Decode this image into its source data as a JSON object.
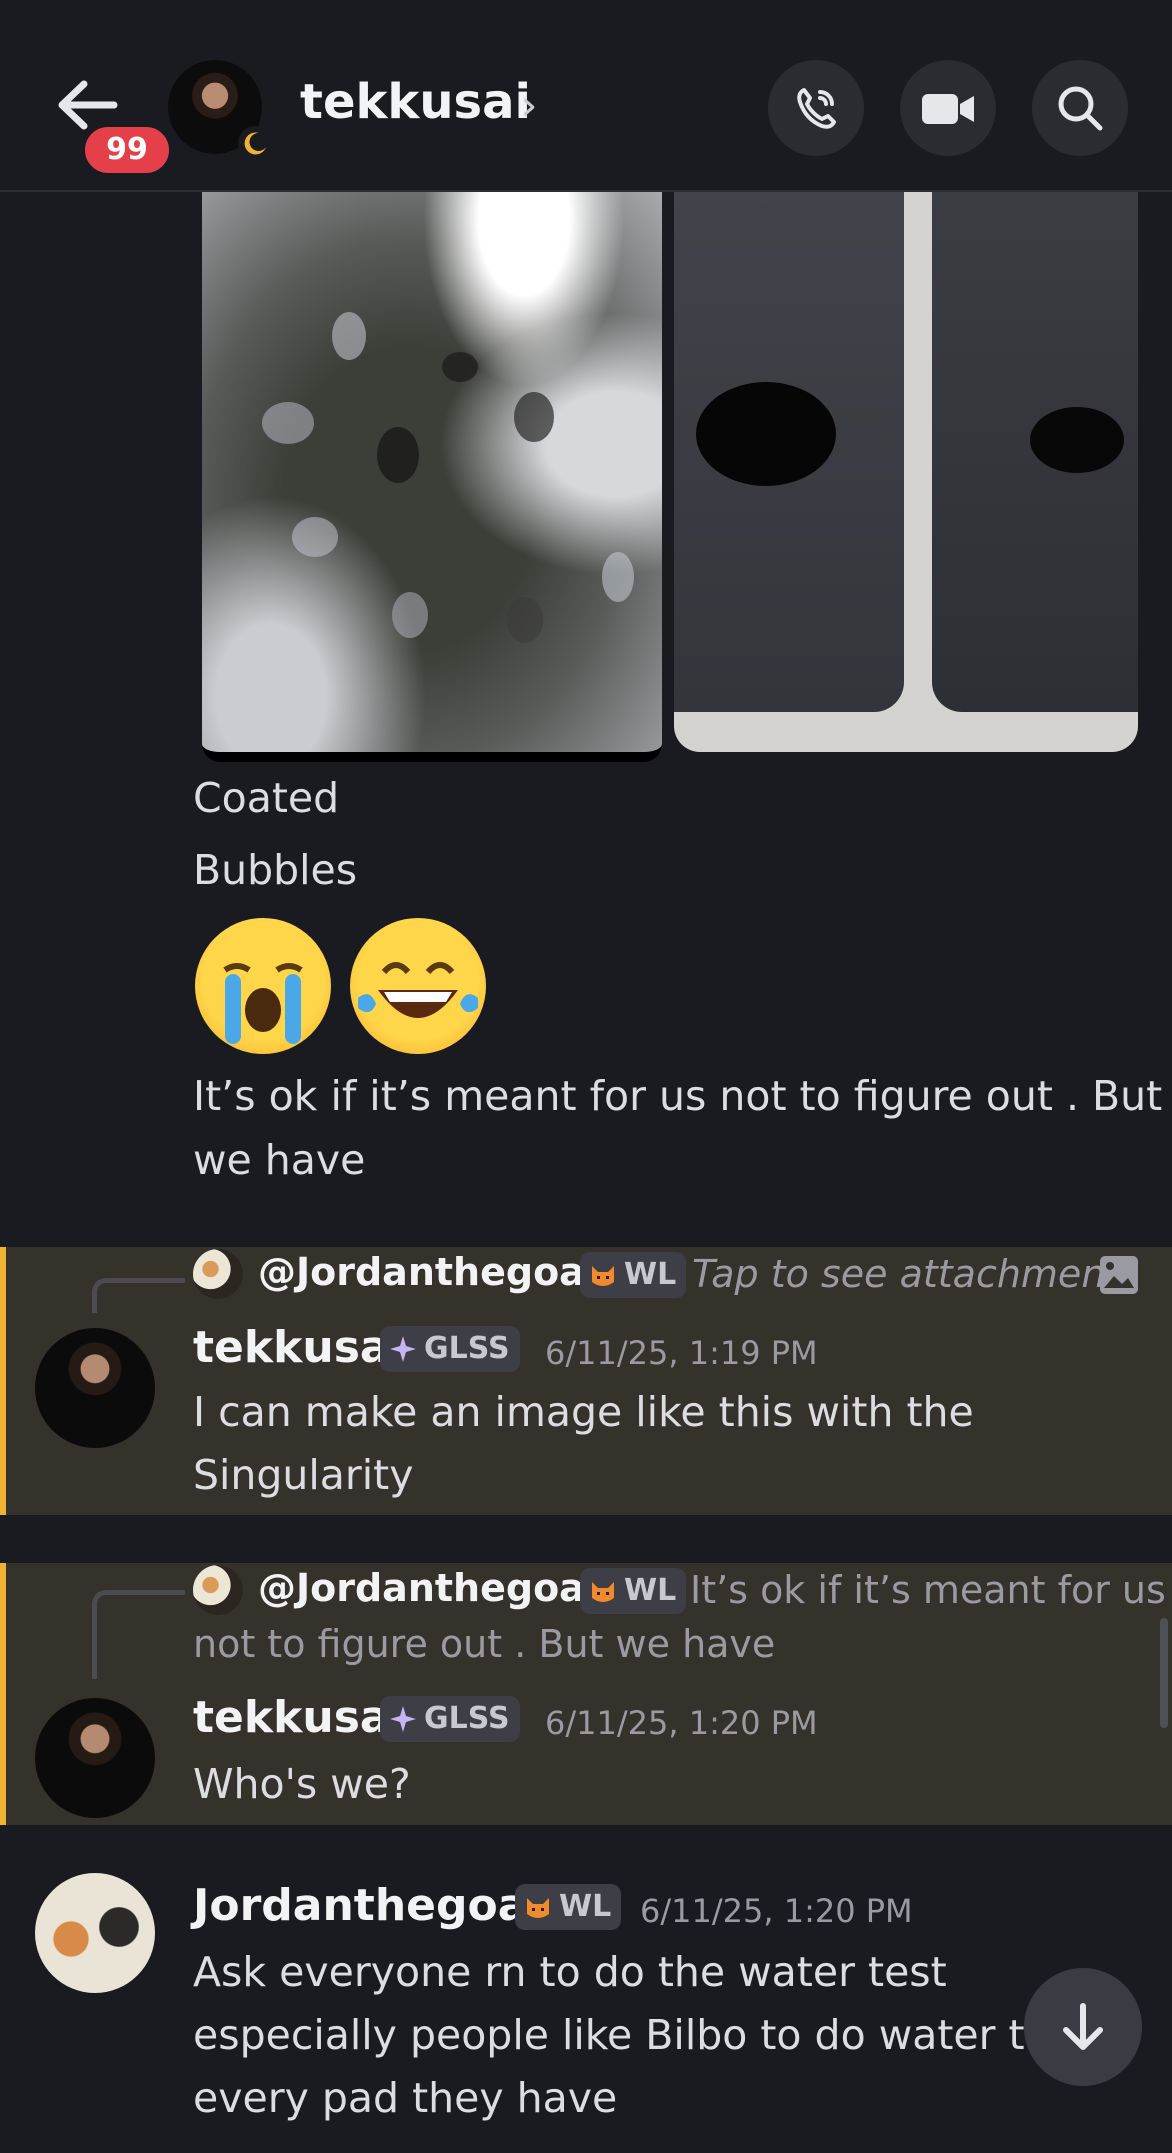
{
  "header": {
    "title": "tekkusai",
    "unread_badge": "99",
    "icons": [
      "back-arrow-icon",
      "phone-call-icon",
      "video-camera-icon",
      "search-icon",
      "chevron-right-icon",
      "moon-status-icon"
    ]
  },
  "messages": {
    "line1": "Coated",
    "line2": "Bubbles",
    "emojis": [
      "loudly-crying-face",
      "face-with-tears-of-joy"
    ],
    "line3": "It’s ok if it’s meant for us not to figure out . But",
    "line4": "we have"
  },
  "reply1": {
    "reply_to": "@Jordanthegoat",
    "reply_tag": "WL",
    "reply_preview": "Tap to see attachment",
    "author": "tekkusai",
    "author_tag": "GLSS",
    "timestamp": "6/11/25, 1:19 PM",
    "text1": "I can make an image like this with the",
    "text2": "Singularity"
  },
  "reply2": {
    "reply_to": "@Jordanthegoat",
    "reply_tag": "WL",
    "reply_preview1": "It’s ok if it’s meant for us",
    "reply_preview2": "not to figure out . But we have",
    "author": "tekkusai",
    "author_tag": "GLSS",
    "timestamp": "6/11/25, 1:20 PM",
    "text": "Who's we?"
  },
  "message3": {
    "author": "Jordanthegoat",
    "author_tag": "WL",
    "timestamp": "6/11/25, 1:20 PM",
    "text1": "Ask everyone rn to do the water test",
    "text2": "especially people like Bilbo to do water te",
    "text3": "every pad they have"
  },
  "colors": {
    "background": "#1a1b20",
    "highlight": "#35312b",
    "highlight_bar": "#f0b232",
    "badge": "#e5404a"
  }
}
